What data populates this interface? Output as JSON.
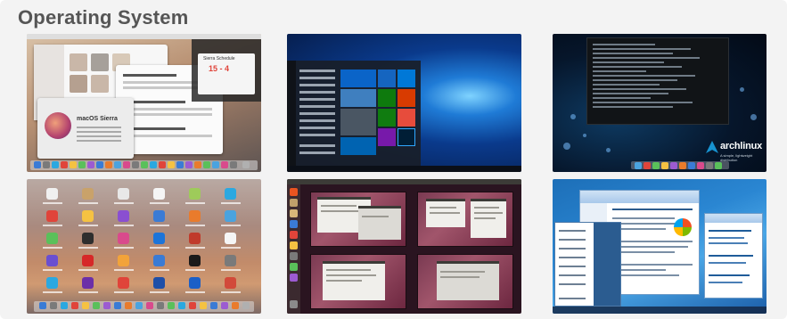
{
  "section": {
    "title": "Operating System"
  },
  "screenshots": [
    {
      "id": "macos-sierra",
      "system_text": "macOS Sierra",
      "widget_title": "Sierra Schedule",
      "widget_number": "15 - 4"
    },
    {
      "id": "windows-10"
    },
    {
      "id": "arch-linux",
      "logo_text": "archlinux",
      "logo_tagline": "A simple, lightweight distribution"
    },
    {
      "id": "macos-launchpad"
    },
    {
      "id": "ubuntu-unity"
    },
    {
      "id": "windows-7"
    }
  ],
  "colors": {
    "title": "#555555",
    "panel_background": "#f3f3f3",
    "win10_accent": "#0a3a8c",
    "arch_blue": "#1793d1"
  }
}
